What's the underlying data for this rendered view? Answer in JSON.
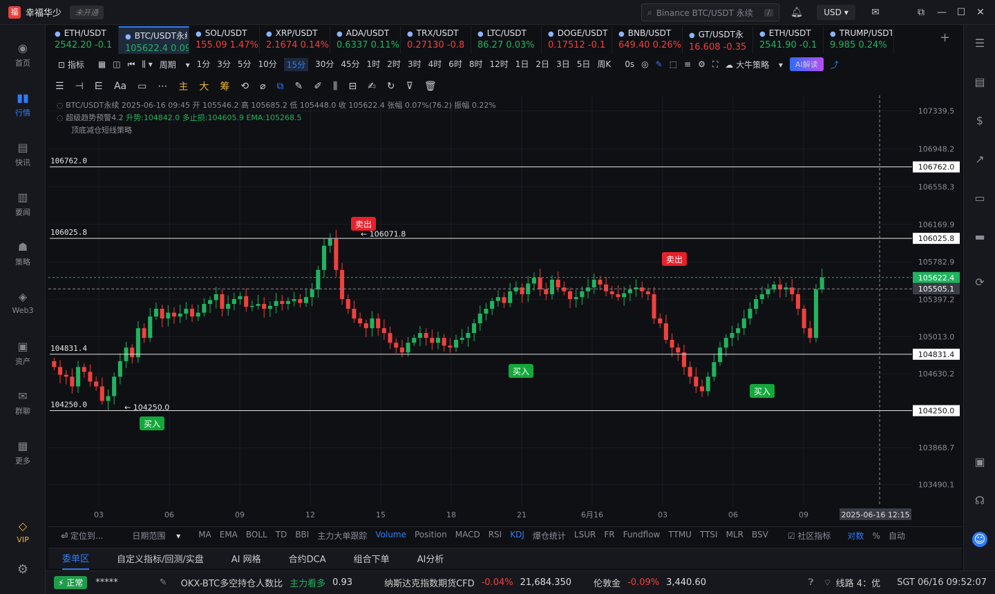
{
  "app": {
    "name": "幸福华少",
    "status_badge": "未开通",
    "search_placeholder": "Binance BTC/USDT 永续",
    "currency": "USD"
  },
  "sidebar": [
    {
      "label": "首页",
      "icon": "home-icon"
    },
    {
      "label": "行情",
      "icon": "chart-icon"
    },
    {
      "label": "快讯",
      "icon": "news-icon"
    },
    {
      "label": "要闻",
      "icon": "headline-icon"
    },
    {
      "label": "策略",
      "icon": "strategy-icon"
    },
    {
      "label": "Web3",
      "icon": "web3-icon"
    },
    {
      "label": "资产",
      "icon": "wallet-icon"
    },
    {
      "label": "群聊",
      "icon": "chat-icon"
    },
    {
      "label": "更多",
      "icon": "grid-icon"
    },
    {
      "label": "VIP",
      "icon": "vip-icon"
    }
  ],
  "tabs": [
    {
      "name": "ETH/USDT",
      "price": "2542.20",
      "change": "-0.1",
      "dir": "up"
    },
    {
      "name": "BTC/USDT永续",
      "price": "105622.4",
      "change": "0.09%",
      "dir": "up",
      "active": true
    },
    {
      "name": "SOL/USDT",
      "price": "155.09",
      "change": "1.47%",
      "dir": "dn"
    },
    {
      "name": "XRP/USDT",
      "price": "2.1674",
      "change": "0.14%",
      "dir": "dn"
    },
    {
      "name": "ADA/USDT",
      "price": "0.6337",
      "change": "0.11%",
      "dir": "up"
    },
    {
      "name": "TRX/USDT",
      "price": "0.27130",
      "change": "-0.8",
      "dir": "dn"
    },
    {
      "name": "LTC/USDT",
      "price": "86.27",
      "change": "0.03%",
      "dir": "up"
    },
    {
      "name": "DOGE/USDT",
      "price": "0.17512",
      "change": "-0.1",
      "dir": "dn"
    },
    {
      "name": "BNB/USDT",
      "price": "649.40",
      "change": "0.26%",
      "dir": "dn"
    },
    {
      "name": "GT/USDT永",
      "price": "16.608",
      "change": "-0.35",
      "dir": "dn"
    },
    {
      "name": "ETH/USDT",
      "price": "2541.90",
      "change": "-0.1",
      "dir": "up"
    },
    {
      "name": "TRUMP/USDT",
      "price": "9.985",
      "change": "0.24%",
      "dir": "up"
    }
  ],
  "toolbar": {
    "indicator": "指标",
    "period": "周期",
    "intervals": [
      "1分",
      "3分",
      "5分",
      "10分",
      "15分",
      "30分",
      "45分",
      "1时",
      "2时",
      "3时",
      "4时",
      "6时",
      "8时",
      "12时",
      "1日",
      "2日",
      "3日",
      "5日",
      "周K"
    ],
    "selected_interval": "15分",
    "countdown": "0s",
    "strategy": "大牛策略",
    "ai": "AI解读"
  },
  "drawtools": [
    "主",
    "大",
    "筹"
  ],
  "legend": {
    "line1": "BTC/USDT永续 2025-06-16 09:45 开 105546.2 高 105685.2 低 105448.0 收 105622.4 张幅 0.07%(76.2) 振幅 0.22%",
    "line2_a": "超级趋势预警4.2",
    "line2_b": "升势:104842.0 多止损:104605.9 EMA:105268.5",
    "line3": "顶底减仓短线策略"
  },
  "chart_data": {
    "type": "candlestick",
    "symbol": "BTC/USDT永续",
    "interval": "15m",
    "y_ticks": [
      107339.5,
      106948.2,
      106558.3,
      106169.9,
      105782.9,
      105397.2,
      105013.0,
      104630.2,
      103868.7,
      103490.1
    ],
    "ylim": [
      103300,
      107500
    ],
    "x_ticks": [
      "03",
      "06",
      "09",
      "12",
      "15",
      "18",
      "21",
      "6月16",
      "03",
      "06",
      "09"
    ],
    "hlines": [
      106762.0,
      106025.8,
      104831.4,
      104250.0
    ],
    "last_price": 105622.4,
    "crosshair_price": 105505.1,
    "crosshair_time": "2025-06-16 12:15",
    "markers": [
      {
        "label": "卖出",
        "price": 106071.8
      },
      {
        "label": "卖出",
        "price": 105800
      },
      {
        "label": "买入",
        "price": 104250.0
      },
      {
        "label": "买入",
        "price": 104600
      },
      {
        "label": "买入",
        "price": 104400
      }
    ],
    "price_labels": [
      "106071.8",
      "104250.0"
    ],
    "colors": {
      "up": "#21b35f",
      "down": "#f0413d"
    },
    "closes": [
      104700,
      104620,
      104600,
      104500,
      104700,
      104650,
      104550,
      104500,
      104350,
      104400,
      104600,
      104760,
      104900,
      104800,
      105100,
      105000,
      105220,
      105300,
      105200,
      105260,
      105220,
      105250,
      105300,
      105220,
      105260,
      105350,
      105390,
      105450,
      105300,
      105350,
      105400,
      105430,
      105320,
      105330,
      105350,
      105300,
      105330,
      105380,
      105350,
      105380,
      105400,
      105360,
      105420,
      105500,
      105700,
      105950,
      106020,
      105700,
      105400,
      105300,
      105200,
      105150,
      105100,
      105200,
      105100,
      105050,
      104950,
      104900,
      104850,
      104950,
      105000,
      105050,
      105000,
      104950,
      105000,
      104920,
      104900,
      104980,
      105000,
      105050,
      105150,
      105250,
      105300,
      105380,
      105420,
      105360,
      105480,
      105520,
      105450,
      105560,
      105620,
      105500,
      105450,
      105600,
      105520,
      105480,
      105400,
      105420,
      105480,
      105520,
      105600,
      105550,
      105480,
      105450,
      105420,
      105460,
      105500,
      105520,
      105480,
      105450,
      105200,
      105150,
      104980,
      104900,
      104850,
      104700,
      104600,
      104500,
      104450,
      104600,
      104750,
      104900,
      105000,
      105050,
      105100,
      105200,
      105300,
      105400,
      105450,
      105500,
      105550,
      105500,
      105520,
      105450,
      105300,
      105100,
      105000,
      105500,
      105622
    ]
  },
  "bottom_indicators": {
    "locate": "定位到...",
    "range": "日期范围",
    "items": [
      "MA",
      "EMA",
      "BOLL",
      "TD",
      "BBI",
      "主力大单跟踪",
      "Volume",
      "Position",
      "MACD",
      "RSI",
      "KDJ",
      "爆仓统计",
      "LSUR",
      "FR",
      "Fundflow",
      "TTMU",
      "TTSI",
      "MLR",
      "BSV"
    ],
    "community": "社区指标",
    "compare": "对数",
    "pct": "%",
    "auto": "自动"
  },
  "panel_tabs": [
    "委单区",
    "自定义指标/回测/实盘",
    "AI 网格",
    "合约DCA",
    "组合下单",
    "AI分析"
  ],
  "status": {
    "state": "正常",
    "account": "*****",
    "ratio_label": "OKX-BTC多空持仓人数比",
    "ratio_side": "主力看多",
    "ratio_value": "0.93",
    "nas_label": "纳斯达克指数期货CFD",
    "nas_change": "-0.04%",
    "nas_value": "21,684.350",
    "gold_label": "伦敦金",
    "gold_change": "-0.09%",
    "gold_value": "3,440.60",
    "line": "线路 4：优",
    "clock": "SGT 06/16 09:52:07"
  }
}
